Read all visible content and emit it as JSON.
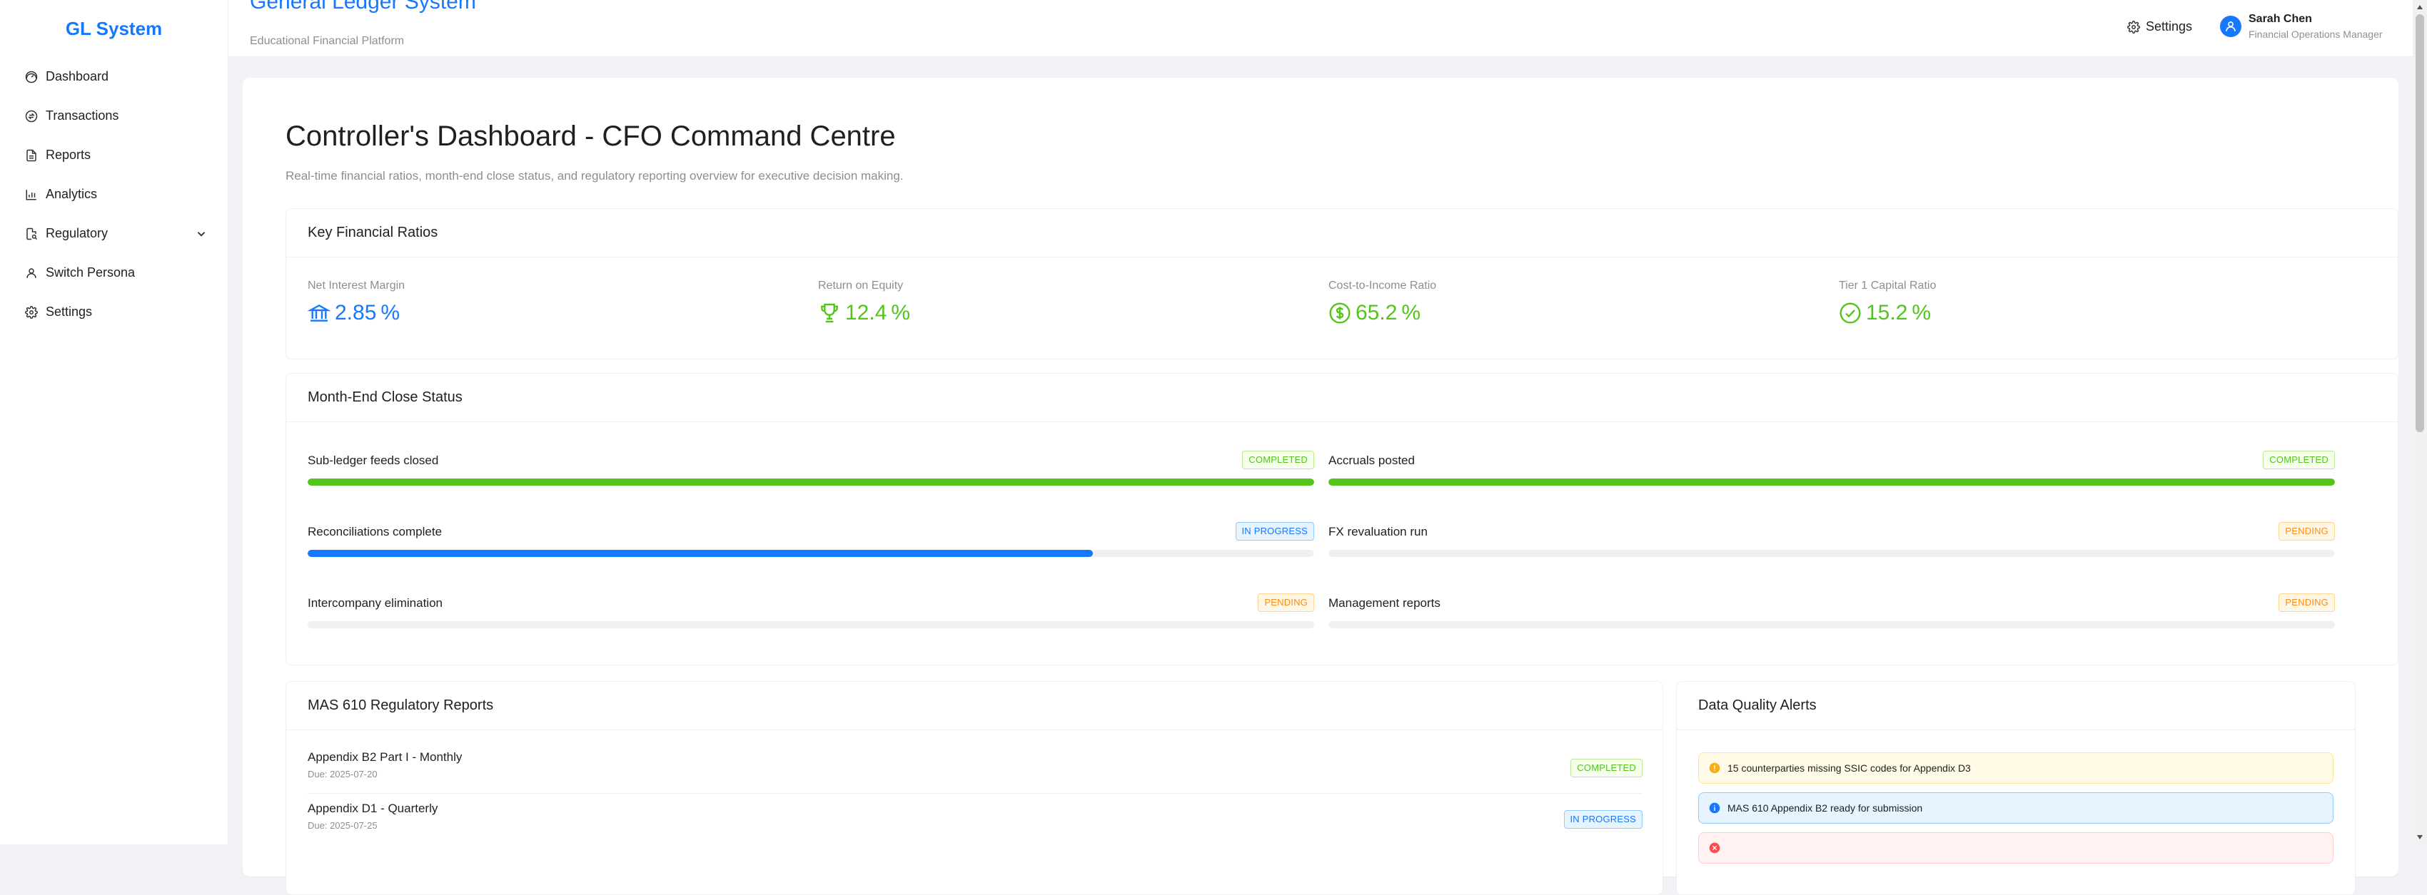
{
  "colors": {
    "primary": "#1677ff",
    "success": "#52c41a",
    "warning": "#fa8c16",
    "info": "#1677ff",
    "error": "#ff4d4f"
  },
  "sidebar": {
    "logo": "GL System",
    "items": [
      {
        "label": "Dashboard",
        "icon": "dashboard-icon"
      },
      {
        "label": "Transactions",
        "icon": "transactions-icon"
      },
      {
        "label": "Reports",
        "icon": "file-icon"
      },
      {
        "label": "Analytics",
        "icon": "bar-chart-icon"
      },
      {
        "label": "Regulatory",
        "icon": "audit-icon",
        "expandable": true
      },
      {
        "label": "Switch Persona",
        "icon": "user-icon"
      },
      {
        "label": "Settings",
        "icon": "gear-icon"
      }
    ]
  },
  "header": {
    "title": "General Ledger System",
    "subtitle": "Educational Financial Platform",
    "settings_label": "Settings",
    "user": {
      "name": "Sarah Chen",
      "role": "Financial Operations Manager"
    }
  },
  "main": {
    "title": "Controller's Dashboard - CFO Command Centre",
    "description": "Real-time financial ratios, month-end close status, and regulatory reporting overview for executive decision making.",
    "ratios": {
      "title": "Key Financial Ratios",
      "items": [
        {
          "label": "Net Interest Margin",
          "value": "2.85",
          "unit": "%",
          "icon": "bank-icon",
          "color": "#1677ff"
        },
        {
          "label": "Return on Equity",
          "value": "12.4",
          "unit": "%",
          "icon": "trophy-icon",
          "color": "#52c41a"
        },
        {
          "label": "Cost-to-Income Ratio",
          "value": "65.2",
          "unit": "%",
          "icon": "dollar-icon",
          "color": "#52c41a"
        },
        {
          "label": "Tier 1 Capital Ratio",
          "value": "15.2",
          "unit": "%",
          "icon": "check-circle-icon",
          "color": "#52c41a"
        }
      ]
    },
    "close_status": {
      "title": "Month-End Close Status",
      "tasks": [
        {
          "label": "Sub-ledger feeds closed",
          "status": "COMPLETED",
          "progress": 1.0
        },
        {
          "label": "Accruals posted",
          "status": "COMPLETED",
          "progress": 1.0
        },
        {
          "label": "Reconciliations complete",
          "status": "IN PROGRESS",
          "progress": 0.78
        },
        {
          "label": "FX revaluation run",
          "status": "PENDING",
          "progress": 0.0
        },
        {
          "label": "Intercompany elimination",
          "status": "PENDING",
          "progress": 0.0
        },
        {
          "label": "Management reports",
          "status": "PENDING",
          "progress": 0.0
        }
      ]
    },
    "reports": {
      "title": "MAS 610 Regulatory Reports",
      "items": [
        {
          "name": "Appendix B2 Part I - Monthly",
          "due": "Due: 2025-07-20",
          "status": "COMPLETED"
        },
        {
          "name": "Appendix D1 - Quarterly",
          "due": "Due: 2025-07-25",
          "status": "IN PROGRESS"
        }
      ]
    },
    "alerts": {
      "title": "Data Quality Alerts",
      "items": [
        {
          "type": "warning",
          "text": "15 counterparties missing SSIC codes for Appendix D3"
        },
        {
          "type": "info",
          "text": "MAS 610 Appendix B2 ready for submission"
        },
        {
          "type": "error",
          "text": ""
        }
      ]
    }
  }
}
